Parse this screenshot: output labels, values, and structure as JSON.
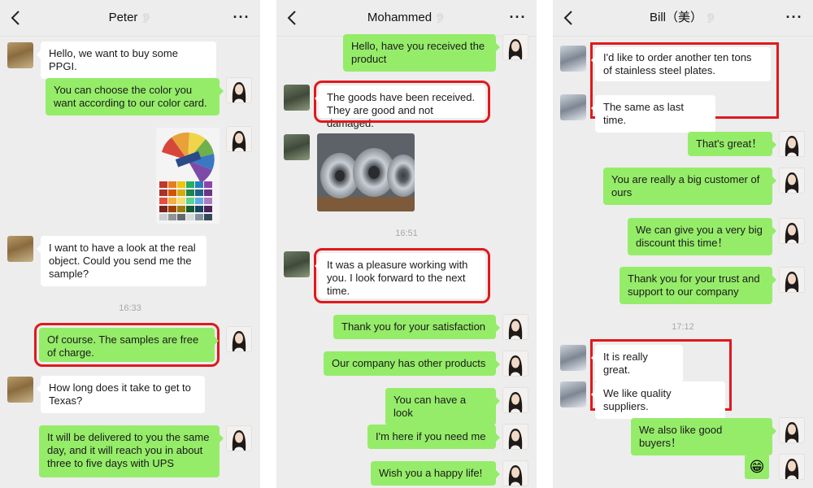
{
  "colors": {
    "outgoing_bubble": "#95ec69",
    "incoming_bubble": "#ffffff",
    "background": "#ededed",
    "highlight_box": "#e0191d"
  },
  "icons": {
    "back": "chevron-left-icon",
    "more": "more-dots-icon",
    "ear": "ear-icon"
  },
  "panels": [
    {
      "title": "Peter",
      "more_label": "···",
      "messages": [
        {
          "from": "them",
          "text": "Hello, we want to buy some PPGI."
        },
        {
          "from": "me",
          "text": "You can choose the color you want according to our color card."
        },
        {
          "from": "me",
          "image": "color-card-photo"
        },
        {
          "from": "them",
          "text": "I want to have a look at the real object. Could you send me the sample?"
        },
        {
          "time": "16:33"
        },
        {
          "from": "me",
          "text": "Of course. The samples are free of charge.",
          "highlighted": true
        },
        {
          "from": "them",
          "text": "How long does it take to get to Texas?"
        },
        {
          "from": "me",
          "text": "It will be delivered to you the same day, and it will reach you in about three to five days with UPS"
        }
      ]
    },
    {
      "title": "Mohammed",
      "more_label": "···",
      "messages": [
        {
          "from": "me",
          "text": "Hello, have you received the product"
        },
        {
          "from": "them",
          "text": "The goods have been received. They are good and not damaged.",
          "highlighted": true
        },
        {
          "from": "them",
          "image": "steel-coils-photo"
        },
        {
          "time": "16:51"
        },
        {
          "from": "them",
          "text": "It was a pleasure working with you. I look forward to the next time.",
          "highlighted": true
        },
        {
          "from": "me",
          "text": "Thank you for your satisfaction"
        },
        {
          "from": "me",
          "text": "Our company has other products"
        },
        {
          "from": "me",
          "text": "You can have a look"
        },
        {
          "from": "me",
          "text": "I'm here if you need me"
        },
        {
          "from": "me",
          "text": "Wish you a happy life!"
        }
      ]
    },
    {
      "title": "Bill（美）",
      "more_label": "···",
      "messages": [
        {
          "from": "them",
          "text": "I'd like to order another ten tons of stainless steel plates.",
          "highlighted": true
        },
        {
          "from": "them",
          "text": "The same as last time.",
          "highlighted": true
        },
        {
          "from": "me",
          "text": "That's great！"
        },
        {
          "from": "me",
          "text": "You are really a big customer of ours"
        },
        {
          "from": "me",
          "text": "We can give you a very big discount this time！"
        },
        {
          "from": "me",
          "text": "Thank you for your trust and support to our company"
        },
        {
          "time": "17:12"
        },
        {
          "from": "them",
          "text": "It is really great.",
          "highlighted": true
        },
        {
          "from": "them",
          "text": "We like quality suppliers.",
          "highlighted": true
        },
        {
          "from": "me",
          "text": "We also like good buyers！"
        },
        {
          "from": "me",
          "emoji": "😁"
        }
      ]
    }
  ]
}
